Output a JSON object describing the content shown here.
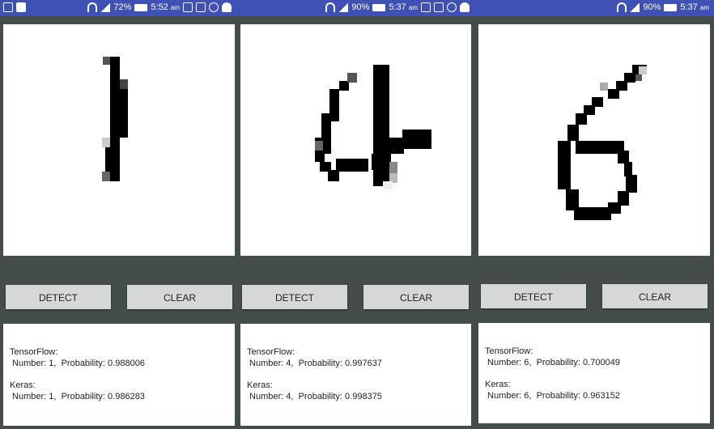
{
  "panels": [
    {
      "status": {
        "signal": "72%",
        "time": "5:52",
        "ampm": "am"
      },
      "buttons": {
        "detect": "DETECT",
        "clear": "CLEAR"
      },
      "results": {
        "tf_label": "TensorFlow:",
        "tf_value": " Number: 1,  Probability: 0.988006",
        "keras_label": "Keras:",
        "keras_value": " Number: 1,  Probability: 0.986283"
      },
      "digit": "1"
    },
    {
      "status": {
        "signal": "90%",
        "time": "5:37",
        "ampm": "am"
      },
      "buttons": {
        "detect": "DETECT",
        "clear": "CLEAR"
      },
      "results": {
        "tf_label": "TensorFlow:",
        "tf_value": " Number: 4,  Probability: 0.997637",
        "keras_label": "Keras:",
        "keras_value": " Number: 4,  Probability: 0.998375"
      },
      "digit": "4"
    },
    {
      "status": {
        "signal": "90%",
        "time": "5:37",
        "ampm": "am"
      },
      "buttons": {
        "detect": "DETECT",
        "clear": "CLEAR"
      },
      "results": {
        "tf_label": "TensorFlow:",
        "tf_value": " Number: 6,  Probability: 0.700049",
        "keras_label": "Keras:",
        "keras_value": " Number: 6,  Probability: 0.963152"
      },
      "digit": "6"
    }
  ],
  "colors": {
    "statusbar": "#3f51b5",
    "background": "#454c4c",
    "button": "#d6d7d7",
    "ink": "#000000"
  }
}
